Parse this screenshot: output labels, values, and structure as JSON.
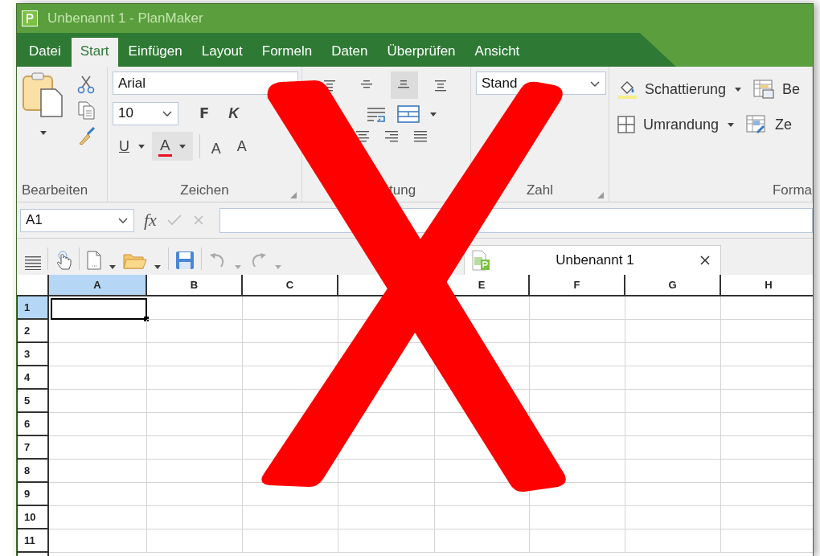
{
  "window": {
    "title": "Unbenannt 1 - PlanMaker"
  },
  "menu_tabs": [
    {
      "label": "Datei",
      "selected": false
    },
    {
      "label": "Start",
      "selected": true
    },
    {
      "label": "Einfügen",
      "selected": false
    },
    {
      "label": "Layout",
      "selected": false
    },
    {
      "label": "Formeln",
      "selected": false
    },
    {
      "label": "Daten",
      "selected": false
    },
    {
      "label": "Überprüfen",
      "selected": false
    },
    {
      "label": "Ansicht",
      "selected": false
    }
  ],
  "ribbon": {
    "groups": [
      {
        "kind": "edit",
        "label": "Bearbeiten"
      },
      {
        "kind": "font",
        "label": "Zeichen",
        "font_name": "Arial",
        "font_size": "10",
        "bold": "F",
        "italic": "K",
        "underline": "U",
        "font_color": "A",
        "grow": "A",
        "shrink": "A"
      },
      {
        "kind": "align",
        "label": "tung",
        "align_buttons": [
          {
            "selected": false
          },
          {
            "selected": false
          },
          {
            "selected": true
          },
          {
            "selected": false
          }
        ]
      },
      {
        "kind": "number",
        "label": "Zahl",
        "number_format": "Stand"
      },
      {
        "kind": "format",
        "label": "Forma",
        "shading": "Schattierung",
        "border": "Umrandung",
        "cut_top": "Be",
        "cut_bottom": "Ze"
      }
    ]
  },
  "formula_bar": {
    "cell_ref": "A1",
    "fx": "fx"
  },
  "document_tab": {
    "title": "Unbenannt 1"
  },
  "sheet": {
    "columns": [
      {
        "label": "A",
        "selected": true
      },
      {
        "label": "B",
        "selected": false
      },
      {
        "label": "C",
        "selected": false
      },
      {
        "selected": false
      },
      {
        "label": "E",
        "selected": false
      },
      {
        "label": "F",
        "selected": false
      },
      {
        "label": "G",
        "selected": false
      },
      {
        "label": "H",
        "selected": false
      }
    ],
    "rows": [
      {
        "label": "1",
        "selected": true
      },
      {
        "label": "2",
        "selected": false
      },
      {
        "label": "3",
        "selected": false
      },
      {
        "label": "4",
        "selected": false
      },
      {
        "label": "5",
        "selected": false
      },
      {
        "label": "6",
        "selected": false
      },
      {
        "label": "7",
        "selected": false
      },
      {
        "label": "8",
        "selected": false
      },
      {
        "label": "9",
        "selected": false
      },
      {
        "label": "10",
        "selected": false
      },
      {
        "label": "11",
        "selected": false
      }
    ]
  }
}
